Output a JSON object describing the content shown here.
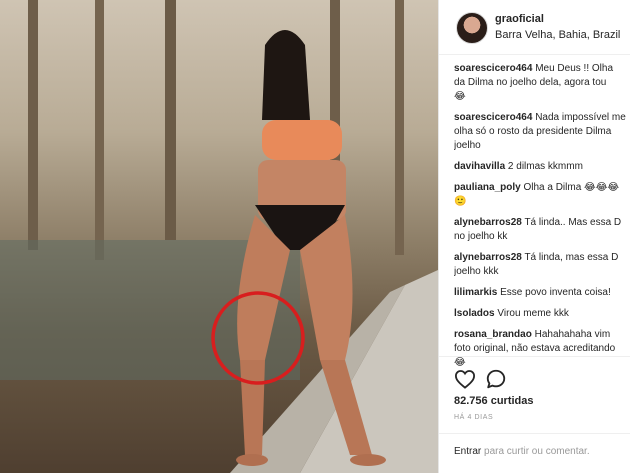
{
  "post": {
    "username": "graoficial",
    "location": "Barra Velha, Bahia, Brazil",
    "photo_annotation": "red circle around knee"
  },
  "comments": [
    {
      "user": "soarescicero464",
      "lines": [
        "Meu Deus !! Olha",
        "da Dilma no joelho dela, agora tou",
        "😂"
      ]
    },
    {
      "user": "soarescicero464",
      "lines": [
        "Nada impossível me",
        "olha só o rosto da presidente Dilma",
        "joelho"
      ]
    },
    {
      "user": "davihavilla",
      "lines": [
        "2 dilmas kkmmm"
      ]
    },
    {
      "user": "pauliana_poly",
      "lines": [
        "Olha a Dilma 😂😂😂",
        "🙂"
      ]
    },
    {
      "user": "alynebarros28",
      "lines": [
        "Tá linda.. Mas essa D",
        "no joelho kk"
      ]
    },
    {
      "user": "alynebarros28",
      "lines": [
        "Tá linda, mas essa D",
        "joelho kkk"
      ]
    },
    {
      "user": "lilimarkis",
      "lines": [
        "Esse povo inventa coisa!"
      ]
    },
    {
      "user": "lsolados",
      "lines": [
        "Virou meme kkk"
      ]
    },
    {
      "user": "rosana_brandao",
      "lines": [
        "Hahahahaha vim",
        "foto original, não estava acreditando",
        "😂"
      ]
    }
  ],
  "actions": {
    "like_icon": "heart-icon",
    "comment_icon": "comment-bubble-icon",
    "likes": "82.756 curtidas",
    "age": "HÁ 4 DIAS"
  },
  "add_comment": {
    "link_text": "Entrar",
    "rest_text": " para curtir ou comentar."
  },
  "colors": {
    "annotation_circle": "#d81e1e",
    "muted_text": "#999999",
    "primary_text": "#262626"
  }
}
